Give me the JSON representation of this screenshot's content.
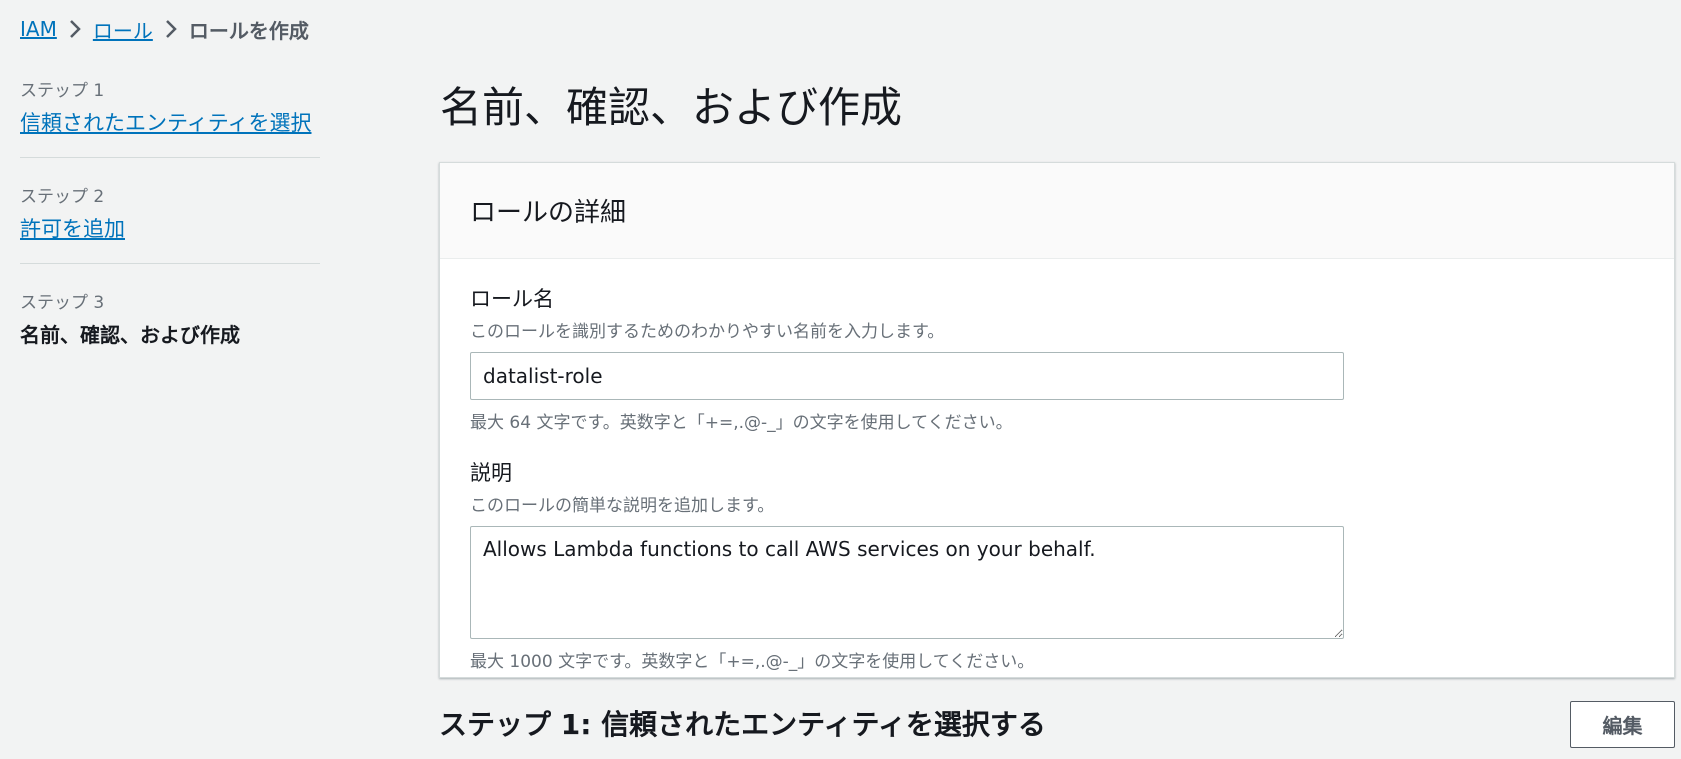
{
  "breadcrumb": {
    "items": [
      {
        "label": "IAM"
      },
      {
        "label": "ロール"
      }
    ],
    "current": "ロールを作成",
    "separator_icon": "chevron-right-icon"
  },
  "wizard": {
    "steps": [
      {
        "number_label": "ステップ 1",
        "label": "信頼されたエンティティを選択",
        "state": "link"
      },
      {
        "number_label": "ステップ 2",
        "label": "許可を追加",
        "state": "link"
      },
      {
        "number_label": "ステップ 3",
        "label": "名前、確認、および作成",
        "state": "current"
      }
    ]
  },
  "page": {
    "title": "名前、確認、および作成"
  },
  "role_details": {
    "panel_title": "ロールの詳細",
    "role_name": {
      "label": "ロール名",
      "description": "このロールを識別するためのわかりやすい名前を入力します。",
      "value": "datalist-role",
      "hint": "最大 64 文字です。英数字と「+=,.@-_」の文字を使用してください。"
    },
    "description_field": {
      "label": "説明",
      "description": "このロールの簡単な説明を追加します。",
      "value": "Allows Lambda functions to call AWS services on your behalf.",
      "hint": "最大 1000 文字です。英数字と「+=,.@-_」の文字を使用してください。"
    }
  },
  "step1_section": {
    "title": "ステップ 1: 信頼されたエンティティを選択する",
    "edit_label": "編集"
  },
  "colors": {
    "link": "#0073bb",
    "background": "#f2f3f3",
    "text": "#16191f",
    "muted": "#687078"
  }
}
